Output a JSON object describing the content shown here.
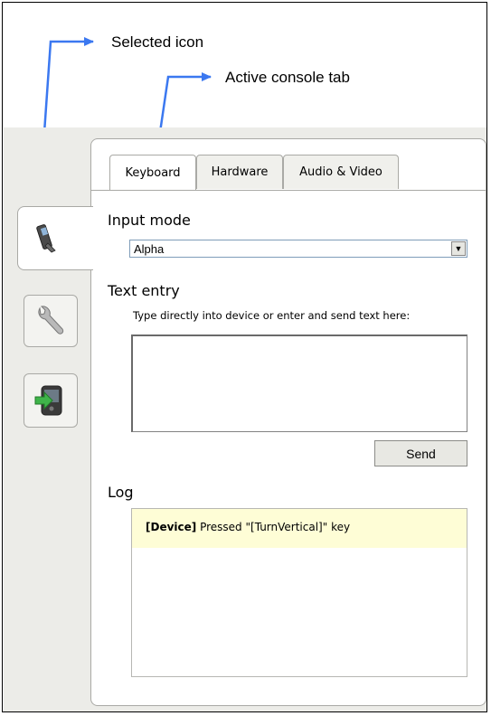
{
  "annotations": {
    "selected_icon": "Selected icon",
    "active_console_tab": "Active console tab"
  },
  "sidebar": {
    "items": [
      {
        "icon": "phone-icon",
        "selected": true
      },
      {
        "icon": "wrench-icon",
        "selected": false
      },
      {
        "icon": "device-sync-icon",
        "selected": false
      }
    ]
  },
  "tabs": [
    {
      "label": "Keyboard",
      "active": true
    },
    {
      "label": "Hardware",
      "active": false
    },
    {
      "label": "Audio & Video",
      "active": false
    }
  ],
  "input_mode": {
    "label": "Input mode",
    "value": "Alpha"
  },
  "text_entry": {
    "label": "Text entry",
    "hint": "Type directly into device or enter and send text here:",
    "value": "",
    "send_label": "Send"
  },
  "log": {
    "label": "Log",
    "entries": [
      {
        "source": "[Device]",
        "message": "Pressed \"[TurnVertical]\" key"
      }
    ]
  },
  "colors": {
    "annotation_arrow": "#3b78f0",
    "log_highlight": "#fefdd6",
    "background": "#ecece8"
  }
}
